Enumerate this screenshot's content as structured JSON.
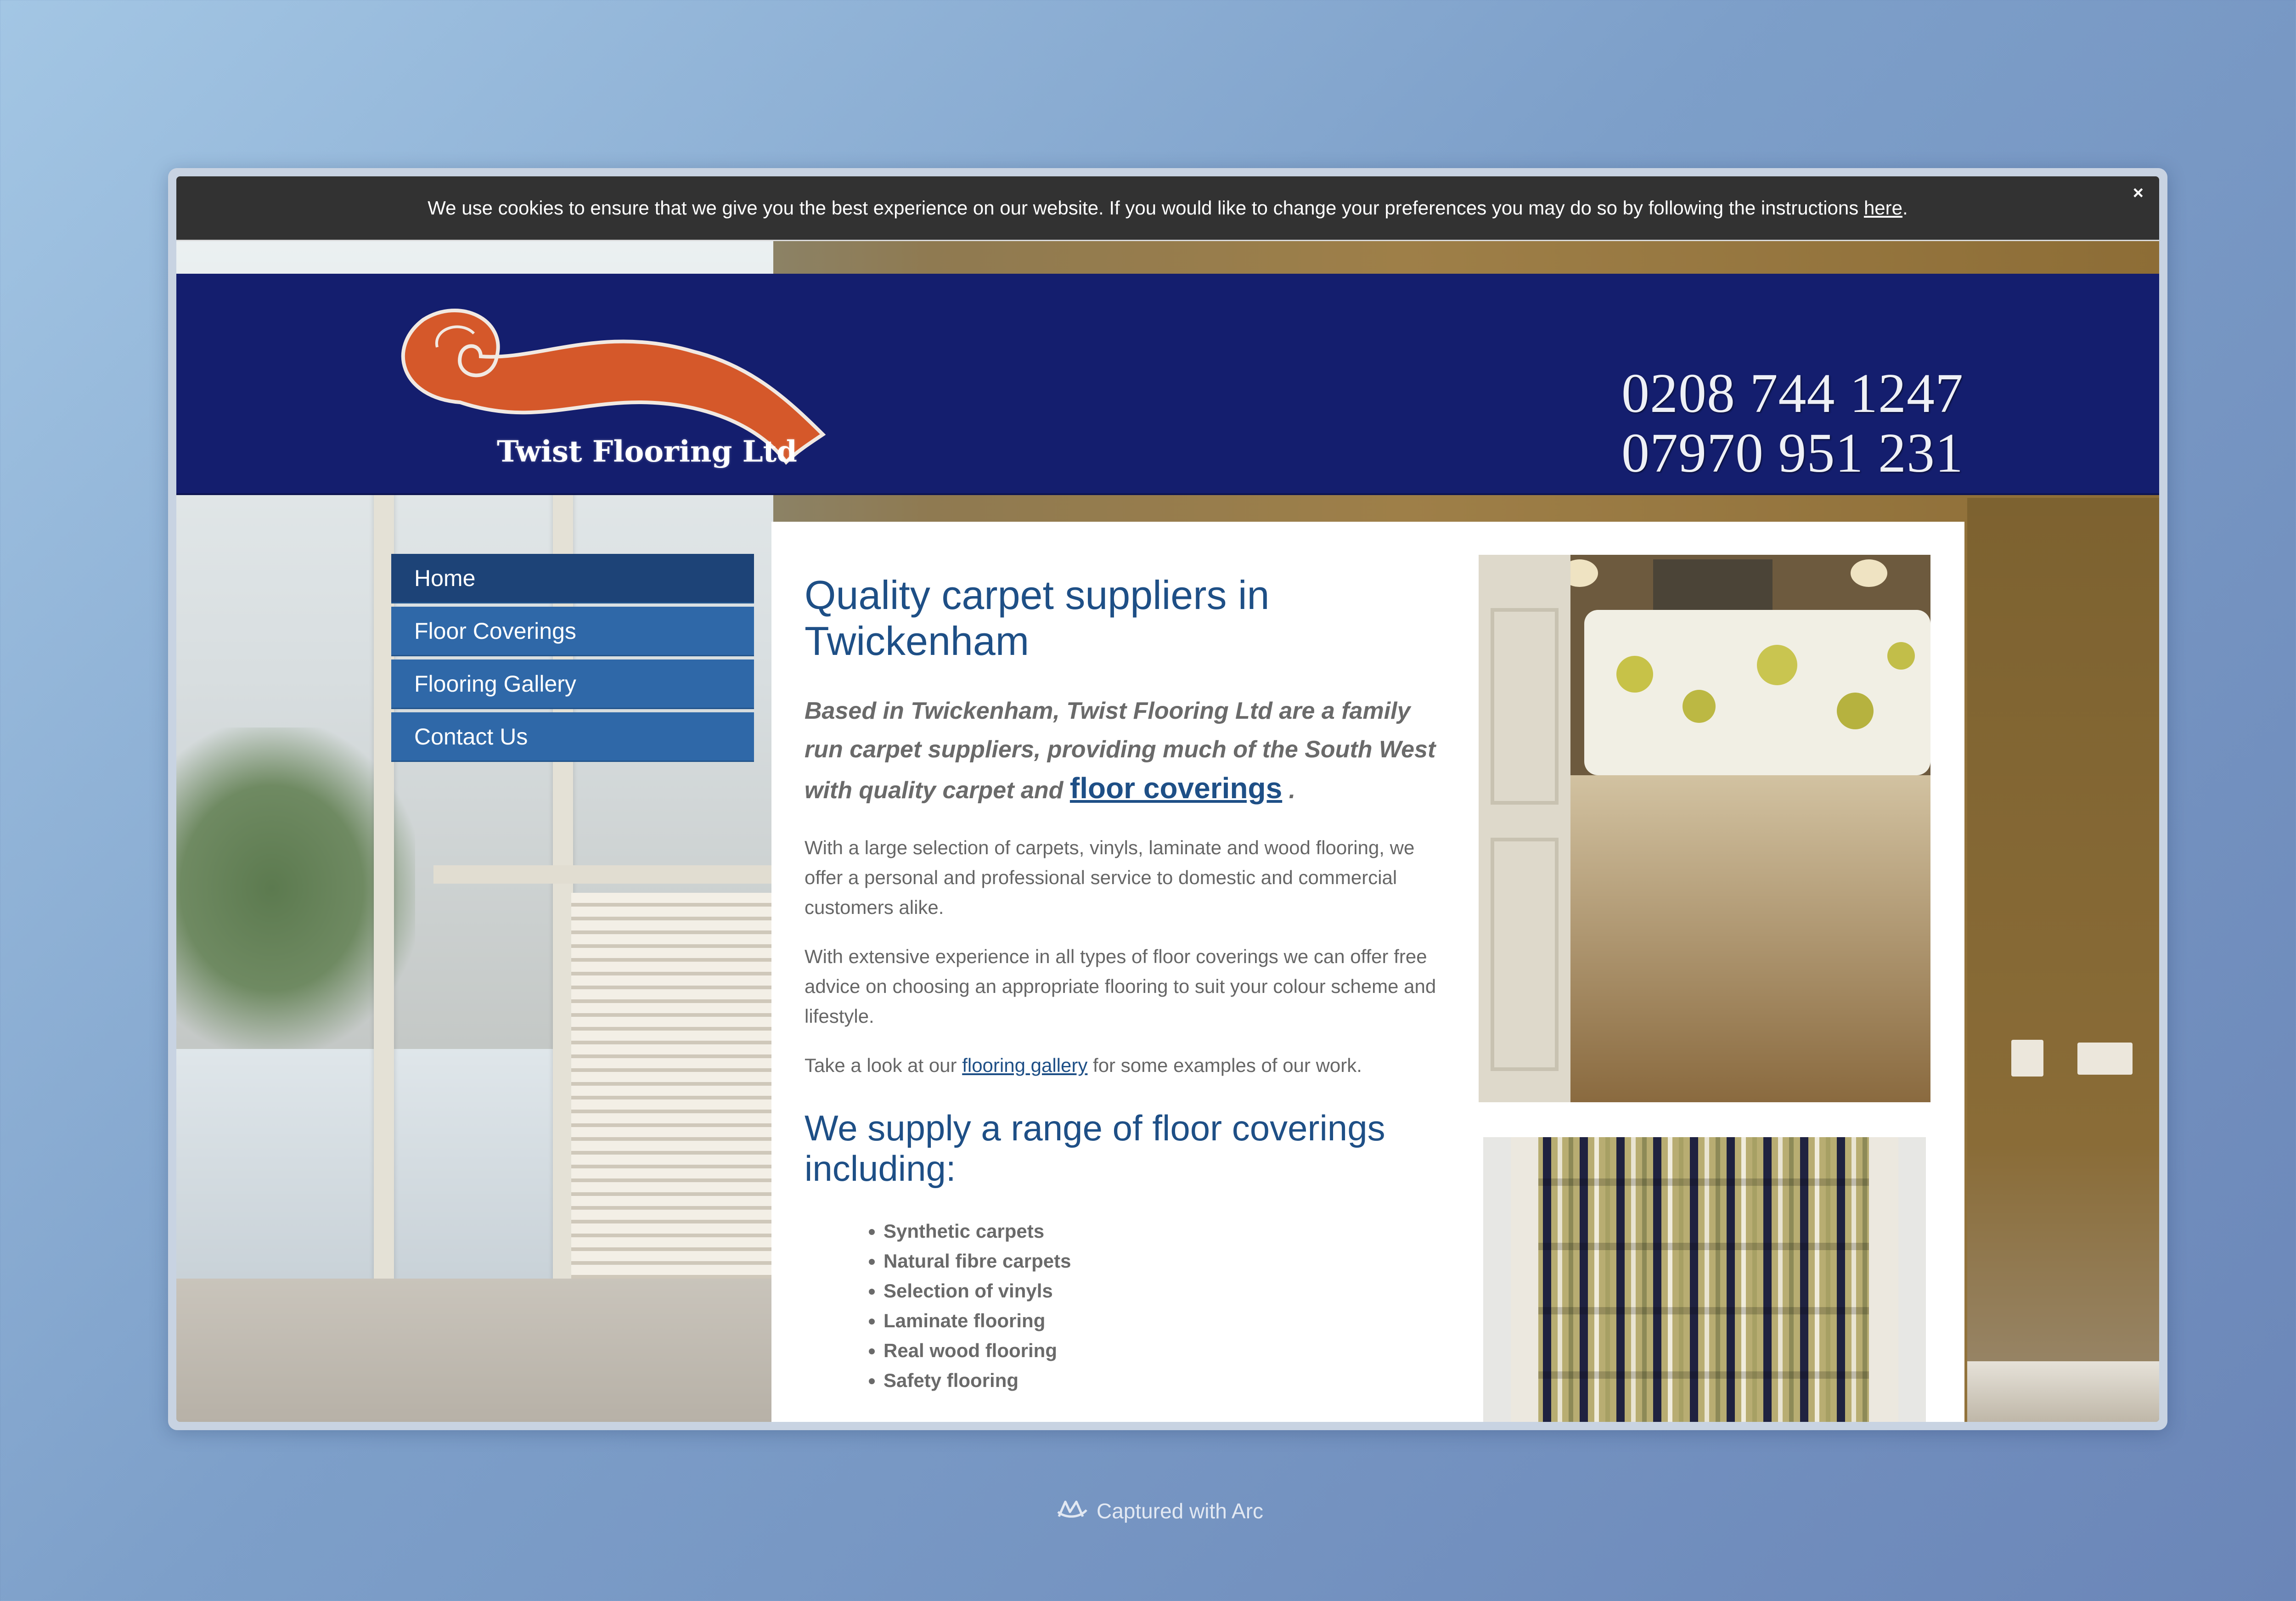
{
  "cookie_bar": {
    "message": "We use cookies to ensure that we give you the best experience on our website. If you would like to change your preferences you may do so by following the instructions",
    "link_text": "here",
    "suffix": ".",
    "close_label": "×"
  },
  "header": {
    "logo_text": "Twist Flooring Ltd",
    "phone_1": "0208 744 1247",
    "phone_2": "07970 951 231"
  },
  "nav": {
    "items": [
      {
        "label": "Home"
      },
      {
        "label": "Floor Coverings"
      },
      {
        "label": "Flooring Gallery"
      },
      {
        "label": "Contact Us"
      }
    ]
  },
  "main": {
    "heading": "Quality carpet suppliers in Twickenham",
    "intro_text": "Based in Twickenham, Twist Flooring Ltd are a family run carpet suppliers, providing much of the South West with quality carpet and",
    "intro_link": "floor coverings",
    "intro_suffix": ".",
    "para_1": "With a large selection of carpets, vinyls, laminate and wood flooring, we offer a personal and professional service to domestic and commercial customers alike.",
    "para_2": "With extensive experience in all types of floor coverings we can offer free advice on choosing an appropriate flooring to suit your colour scheme and lifestyle.",
    "para_3_prefix": "Take a look at our",
    "para_3_link": "flooring gallery",
    "para_3_suffix": "for some examples of our work.",
    "subheading": "We supply a range of floor coverings including:",
    "ranges": [
      "Synthetic carpets",
      "Natural fibre carpets",
      "Selection of vinyls",
      "Laminate flooring",
      "Real wood flooring",
      "Safety flooring"
    ]
  },
  "footer_caption": "Captured with Arc",
  "colors": {
    "header_bg": "#141e6e",
    "nav_bg": "#2f68a8",
    "nav_active_bg": "#1d4377",
    "heading": "#1e4f86",
    "logo_swirl": "#d5582a"
  }
}
